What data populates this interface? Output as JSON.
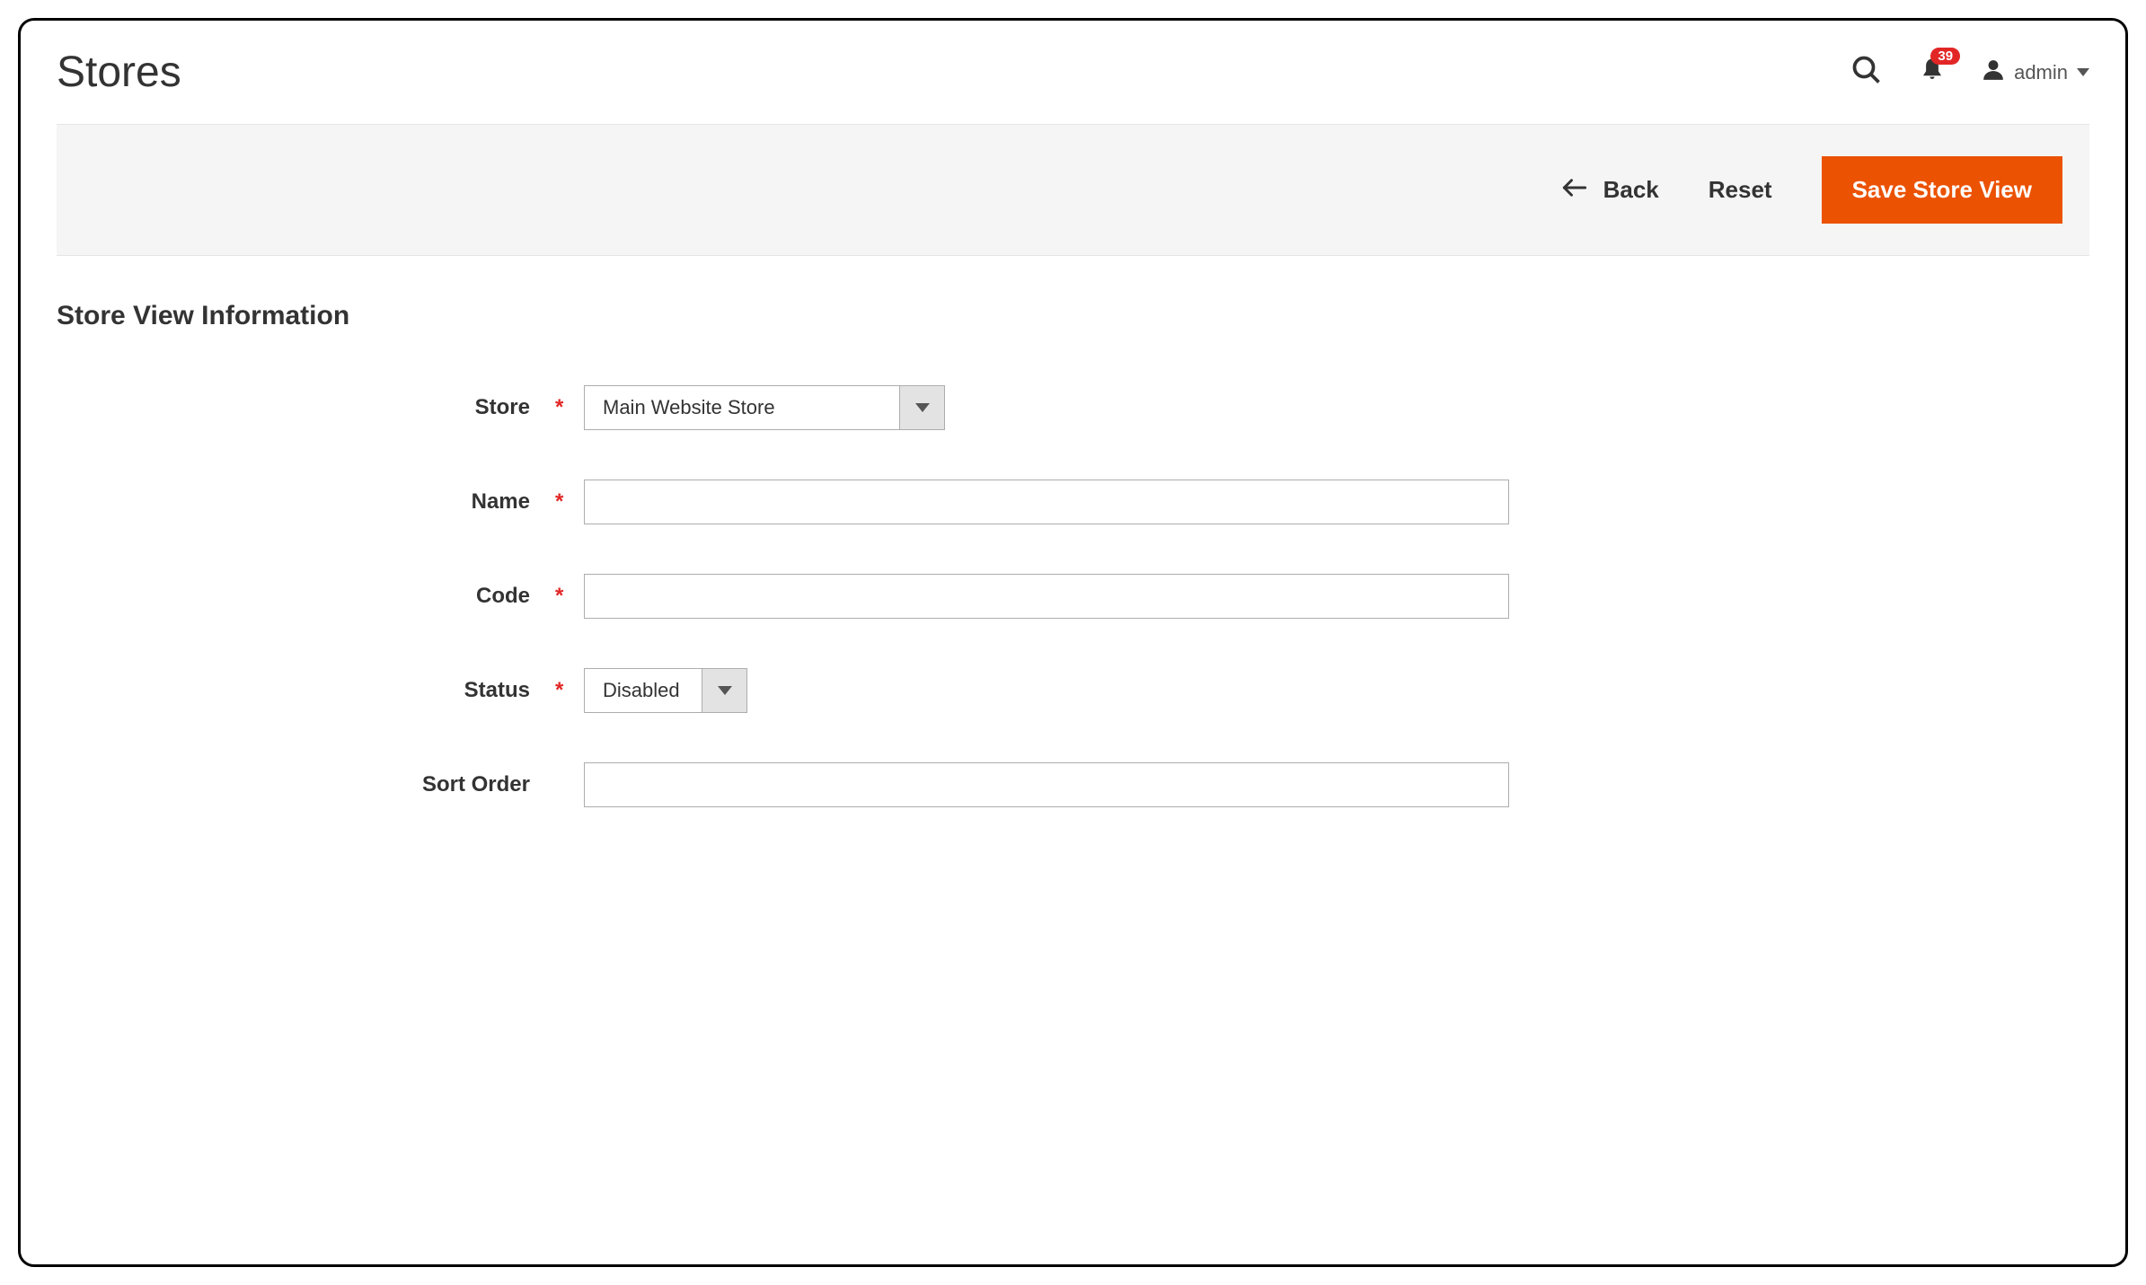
{
  "header": {
    "title": "Stores",
    "notifications_count": "39",
    "user_name": "admin"
  },
  "toolbar": {
    "back_label": "Back",
    "reset_label": "Reset",
    "save_label": "Save Store View"
  },
  "section": {
    "title": "Store View Information"
  },
  "form": {
    "store": {
      "label": "Store",
      "required": true,
      "value": "Main Website Store"
    },
    "name": {
      "label": "Name",
      "required": true,
      "value": ""
    },
    "code": {
      "label": "Code",
      "required": true,
      "value": ""
    },
    "status": {
      "label": "Status",
      "required": true,
      "value": "Disabled"
    },
    "sort_order": {
      "label": "Sort Order",
      "required": false,
      "value": ""
    }
  }
}
